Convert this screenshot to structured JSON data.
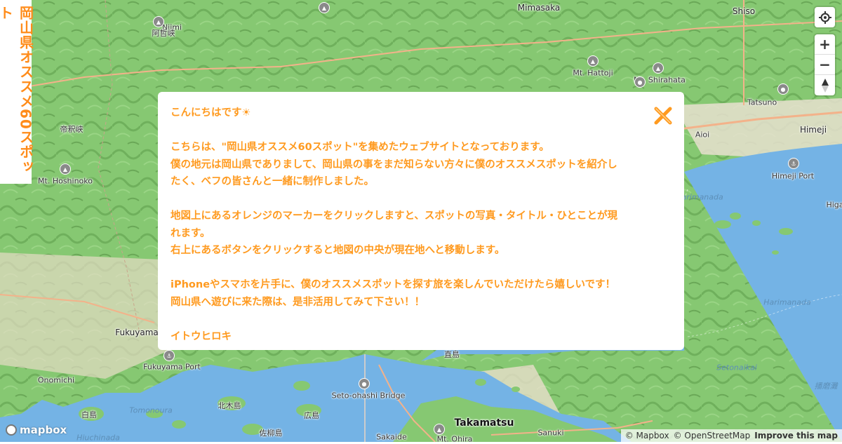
{
  "site_title": "岡山県オススメ60スポット",
  "map": {
    "places": [
      {
        "name": "Mimasaka",
        "size": "mid"
      },
      {
        "name": "Shiso",
        "size": "mid"
      },
      {
        "name": "Niimi",
        "size": "small"
      },
      {
        "name": "阿哲峡",
        "size": "small"
      },
      {
        "name": "Mt. Hattoji",
        "size": "small"
      },
      {
        "name": "Mt. Shirahata",
        "size": "small"
      },
      {
        "name": "帝釈峡",
        "size": "small"
      },
      {
        "name": "Mt. Hoshinoko",
        "size": "small"
      },
      {
        "name": "Tatsuno",
        "size": "small"
      },
      {
        "name": "Aioi",
        "size": "small"
      },
      {
        "name": "Himeji",
        "size": "mid"
      },
      {
        "name": "Himeji Port",
        "size": "small"
      },
      {
        "name": "Fukuyama",
        "size": "mid"
      },
      {
        "name": "Fukuyama Port",
        "size": "small"
      },
      {
        "name": "Onomichi",
        "size": "small"
      },
      {
        "name": "北木島",
        "size": "small"
      },
      {
        "name": "白島",
        "size": "small"
      },
      {
        "name": "佐柳島",
        "size": "small"
      },
      {
        "name": "広島",
        "size": "small"
      },
      {
        "name": "直島",
        "size": "small"
      },
      {
        "name": "Seto-ohashi Bridge",
        "size": "small"
      },
      {
        "name": "Sakaide",
        "size": "small"
      },
      {
        "name": "Takamatsu",
        "size": "big"
      },
      {
        "name": "Sanuki",
        "size": "small"
      },
      {
        "name": "Mt. Ohira",
        "size": "small"
      },
      {
        "name": "Higa",
        "size": "small"
      }
    ],
    "seas": [
      {
        "name": "Harimanada"
      },
      {
        "name": "Harimanada"
      },
      {
        "name": "Setonaikai"
      },
      {
        "name": "Tomonoura"
      },
      {
        "name": "Hiuchinada"
      },
      {
        "name": "播磨灘"
      }
    ]
  },
  "controls": {
    "geolocate_icon": "crosshair-icon",
    "zoom_in_label": "+",
    "zoom_out_label": "−",
    "compass_icon": "compass-icon"
  },
  "modal": {
    "greeting": "こんにちはです☀",
    "paragraph1_line1": "こちらは、\"岡山県オススメ60スポット\"を集めたウェブサイトとなっております。",
    "paragraph1_line2": "僕の地元は岡山県でありまして、岡山県の事をまだ知らない方々に僕のオススメスポットを紹介し",
    "paragraph1_line3": "たく、ベフの皆さんと一緒に制作しました。",
    "paragraph2_line1": "地図上にあるオレンジのマーカーをクリックしますと、スポットの写真・タイトル・ひとことが現",
    "paragraph2_line2": "れます。",
    "paragraph2_line3": "右上にあるボタンをクリックすると地図の中央が現在地へと移動します。",
    "paragraph3_line1": "iPhoneやスマホを片手に、僕のオススメスポットを探す旅を楽しんでいただけたら嬉しいです！",
    "paragraph3_line2": "岡山県へ遊びに来た際は、是非活用してみて下さい！！",
    "signature": "イトウヒロキ",
    "close_icon": "close-icon",
    "accent_color": "#ff9a1f"
  },
  "footer": {
    "logo_text": "mapbox",
    "attribution_mapbox": "© Mapbox",
    "attribution_osm": "© OpenStreetMap",
    "improve_link": "Improve this map"
  }
}
